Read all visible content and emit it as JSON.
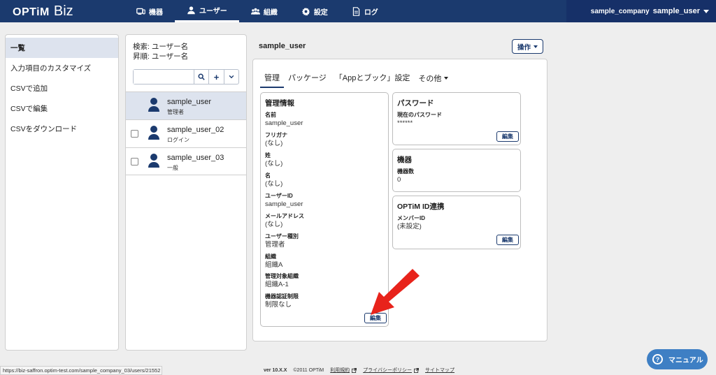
{
  "header": {
    "logo_main": "OPTiM",
    "logo_sub": "Biz",
    "nav": [
      {
        "label": "機器",
        "icon": "device-icon"
      },
      {
        "label": "ユーザー",
        "icon": "user-icon",
        "active": true
      },
      {
        "label": "組織",
        "icon": "organization-icon"
      },
      {
        "label": "設定",
        "icon": "gear-icon"
      },
      {
        "label": "ログ",
        "icon": "log-icon"
      }
    ],
    "company": "sample_company",
    "user": "sample_user"
  },
  "left_menu": {
    "items": [
      "一覧",
      "入力項目のカスタマイズ",
      "CSVで追加",
      "CSVで編集",
      "CSVをダウンロード"
    ]
  },
  "user_list": {
    "filter_search": "検索: ユーザー名",
    "filter_sort": "昇順: ユーザー名",
    "search_placeholder": "",
    "add_label": "+",
    "users": [
      {
        "name": "sample_user",
        "role": "管理者"
      },
      {
        "name": "sample_user_02",
        "role": "ログイン"
      },
      {
        "name": "sample_user_03",
        "role": "一般"
      }
    ]
  },
  "detail": {
    "title": "sample_user",
    "action_label": "操作",
    "tabs": [
      "管理",
      "パッケージ",
      "「Appとブック」設定",
      "その他"
    ],
    "management": {
      "heading": "管理情報",
      "fields": [
        {
          "label": "名前",
          "value": "sample_user"
        },
        {
          "label": "フリガナ",
          "value": "(なし)"
        },
        {
          "label": "姓",
          "value": "(なし)"
        },
        {
          "label": "名",
          "value": "(なし)"
        },
        {
          "label": "ユーザーID",
          "value": "sample_user"
        },
        {
          "label": "メールアドレス",
          "value": "(なし)"
        },
        {
          "label": "ユーザー種別",
          "value": "管理者"
        },
        {
          "label": "組織",
          "value": "組織A"
        },
        {
          "label": "管理対象組織",
          "value": "組織A-1"
        },
        {
          "label": "機器認証制限",
          "value": "制限なし"
        }
      ],
      "edit_label": "編集"
    },
    "password": {
      "heading": "パスワード",
      "label": "現在のパスワード",
      "value": "******",
      "edit_label": "編集"
    },
    "devices": {
      "heading": "機器",
      "label": "機器数",
      "value": "0"
    },
    "optim_id": {
      "heading": "OPTiM ID連携",
      "label": "メンバーID",
      "value": "(未設定)",
      "edit_label": "編集"
    }
  },
  "footer": {
    "status_url": "https://biz-saffron.optim-test.com/sample_company_03/users/21552",
    "version": "ver 10.X.X",
    "copyright": "©2011 OPTiM",
    "terms": "利用規約",
    "privacy": "プライバシーポリシー",
    "sitemap": "サイトマップ"
  },
  "manual_label": "マニュアル",
  "colors": {
    "primary": "#1b3a6e",
    "selected": "#dde3ee",
    "arrow": "#e8231b",
    "manual": "#3e7fc4"
  }
}
